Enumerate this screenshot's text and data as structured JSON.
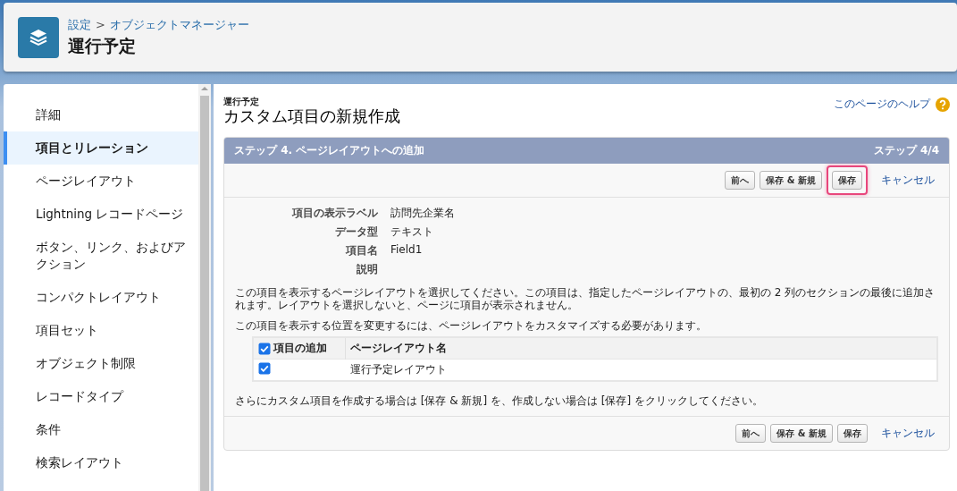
{
  "header": {
    "breadcrumb": [
      {
        "label": "設定"
      },
      {
        "label": "オブジェクトマネージャー"
      }
    ],
    "separator": ">",
    "title": "運行予定"
  },
  "sidebar": {
    "items": [
      {
        "label": "詳細",
        "selected": false
      },
      {
        "label": "項目とリレーション",
        "selected": true
      },
      {
        "label": "ページレイアウト",
        "selected": false
      },
      {
        "label": "Lightning レコードページ",
        "selected": false
      },
      {
        "label": "ボタン、リンク、およびアクション",
        "selected": false
      },
      {
        "label": "コンパクトレイアウト",
        "selected": false
      },
      {
        "label": "項目セット",
        "selected": false
      },
      {
        "label": "オブジェクト制限",
        "selected": false
      },
      {
        "label": "レコードタイプ",
        "selected": false
      },
      {
        "label": "条件",
        "selected": false
      },
      {
        "label": "検索レイアウト",
        "selected": false
      }
    ]
  },
  "page": {
    "subtitle": "運行予定",
    "title": "カスタム項目の新規作成",
    "help_link": "このページのヘルプ"
  },
  "wizard": {
    "step_title": "ステップ 4. ページレイアウトへの追加",
    "step_count": "ステップ 4/4",
    "top_buttons": [
      {
        "label": "前へ",
        "highlighted": false
      },
      {
        "label": "保存 & 新規",
        "highlighted": false
      },
      {
        "label": "保存",
        "highlighted": true
      }
    ],
    "top_cancel": "キャンセル",
    "fields": [
      {
        "label": "項目の表示ラベル",
        "value": "訪問先企業名"
      },
      {
        "label": "データ型",
        "value": "テキスト"
      },
      {
        "label": "項目名",
        "value": "Field1"
      },
      {
        "label": "説明"
      }
    ],
    "instruction": "この項目を表示するページレイアウトを選択してください。この項目は、指定したページレイアウトの、最初の 2 列のセクションの最後に追加されます。レイアウトを選択しないと、ページに項目が表示されません。",
    "customize_note": "この項目を表示する位置を変更するには、ページレイアウトをカスタマイズする必要があります。",
    "table": {
      "columns": [
        {
          "label": "項目の追加",
          "checked": true
        },
        {
          "label": "ページレイアウト名"
        }
      ],
      "rows": [
        {
          "checked": true,
          "layout": "運行予定レイアウト"
        }
      ]
    },
    "footer_note": "さらにカスタム項目を作成する場合は [保存 & 新規] を、作成しない場合は [保存] をクリックしてください。",
    "bottom_buttons": [
      {
        "label": "前へ",
        "highlighted": false
      },
      {
        "label": "保存 & 新規",
        "highlighted": false
      },
      {
        "label": "保存",
        "highlighted": false
      }
    ],
    "bottom_cancel": "キャンセル"
  }
}
